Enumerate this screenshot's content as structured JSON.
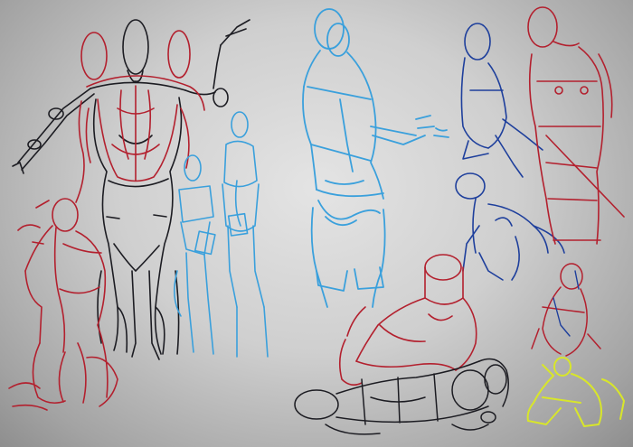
{
  "image": {
    "description_colors": {
      "background": "#c9c9c9",
      "black": "#1c1c22",
      "red": "#b3202e",
      "blue_light": "#3aa0dc",
      "blue_dark": "#1e3f9c",
      "yellow": "#d8e62a"
    }
  }
}
